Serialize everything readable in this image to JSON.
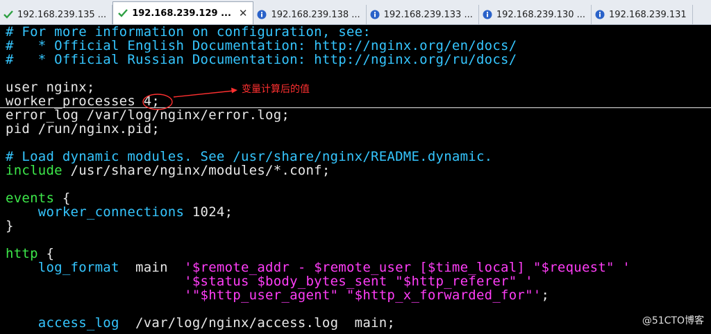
{
  "tabs": [
    {
      "label": "192.168.239.135 ...",
      "icon": "check-icon",
      "active": false
    },
    {
      "label": "192.168.239.129 ...",
      "icon": "check-icon",
      "active": true,
      "close": "✕"
    },
    {
      "label": "192.168.239.138 ...",
      "icon": "info-icon",
      "active": false
    },
    {
      "label": "192.168.239.133 ...",
      "icon": "info-icon",
      "active": false
    },
    {
      "label": "192.168.239.130 ...",
      "icon": "info-icon",
      "active": false
    },
    {
      "label": "192.168.239.131",
      "icon": "info-icon",
      "active": false
    }
  ],
  "terminal": {
    "l1": "# For more information on configuration, see:",
    "l2": "#   * Official English Documentation: http://nginx.org/en/docs/",
    "l3": "#   * Official Russian Documentation: http://nginx.org/ru/docs/",
    "l5": "user nginx;",
    "l6a": "worker_processes",
    "l6b": " 4;",
    "l7": "error_log /var/log/nginx/error.log;",
    "l8": "pid /run/nginx.pid;",
    "l10": "# Load dynamic modules. See /usr/share/nginx/README.dynamic.",
    "l11a": "include",
    "l11b": " /usr/share/nginx/modules/*.conf;",
    "l13a": "events",
    "l13b": " {",
    "l14a": "    worker_connections",
    "l14b": " 1024;",
    "l15": "}",
    "l17a": "http",
    "l17b": " {",
    "l18a": "    log_format",
    "l18b": "  main  ",
    "l18c": "'$remote_addr - $remote_user ",
    "l18d": "[$time_local]",
    "l18e": " \"$request\" '",
    "l19a": "                      '$status $body_bytes_sent \"$http_referer\" '",
    "l20a": "                      '\"$http_user_agent\" \"$http_x_forwarded_for\"'",
    "l20b": ";",
    "l22a": "    access_log",
    "l22b": "  /var/log/nginx/access.log  main;"
  },
  "annotation": {
    "text": "变量计算后的值",
    "color": "#ff3030"
  },
  "watermark": "@51CTO博客"
}
